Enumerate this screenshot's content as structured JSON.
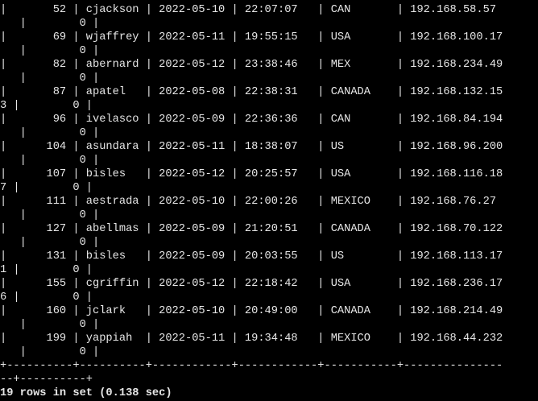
{
  "terminal": {
    "background": "#000000",
    "foreground": "#e6e6e6",
    "lines": [
      "|       52 | cjackson | 2022-05-10 | 22:07:07   | CAN       | 192.168.58.57",
      "   |        0 |",
      "|       69 | wjaffrey | 2022-05-11 | 19:55:15   | USA       | 192.168.100.17",
      "   |        0 |",
      "|       82 | abernard | 2022-05-12 | 23:38:46   | MEX       | 192.168.234.49",
      "   |        0 |",
      "|       87 | apatel   | 2022-05-08 | 22:38:31   | CANADA    | 192.168.132.15",
      "3 |        0 |",
      "|       96 | ivelasco | 2022-05-09 | 22:36:36   | CAN       | 192.168.84.194",
      "   |        0 |",
      "|      104 | asundara | 2022-05-11 | 18:38:07   | US        | 192.168.96.200",
      "   |        0 |",
      "|      107 | bisles   | 2022-05-12 | 20:25:57   | USA       | 192.168.116.18",
      "7 |        0 |",
      "|      111 | aestrada | 2022-05-10 | 22:00:26   | MEXICO    | 192.168.76.27",
      "   |        0 |",
      "|      127 | abellmas | 2022-05-09 | 21:20:51   | CANADA    | 192.168.70.122",
      "   |        0 |",
      "|      131 | bisles   | 2022-05-09 | 20:03:55   | US        | 192.168.113.17",
      "1 |        0 |",
      "|      155 | cgriffin | 2022-05-12 | 22:18:42   | USA       | 192.168.236.17",
      "6 |        0 |",
      "|      160 | jclark   | 2022-05-10 | 20:49:00   | CANADA    | 192.168.214.49",
      "   |        0 |",
      "|      199 | yappiah  | 2022-05-11 | 19:34:48   | MEXICO    | 192.168.44.232",
      "   |        0 |",
      "+----------+----------+------------+------------+-----------+---------------",
      "--+----------+",
      "19 rows in set (0.138 sec)"
    ]
  }
}
